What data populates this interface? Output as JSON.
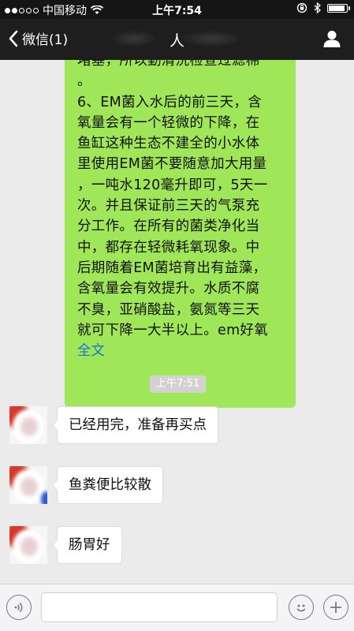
{
  "status_bar": {
    "carrier": "中国移动",
    "time": "上午7:54"
  },
  "nav": {
    "back_label": "微信(1)",
    "title": "人"
  },
  "chat": {
    "outgoing_message": {
      "text": "堵塞，所以勤清洗检查过滤棉\n。\n6、EM菌入水后的前三天，含\n氧量会有一个轻微的下降，在\n鱼缸这种生态不建全的小水体\n里使用EM菌不要随意加大用量\n，一吨水120毫升即可，5天一\n次。并且保证前三天的气泵充\n分工作。在所有的菌类净化当\n中，都存在轻微耗氧现象。中\n后期随着EM菌培育出有益藻，\n含氧量会有效提升。水质不腐\n不臭，亚硝酸盐，氨氮等三天\n就可下降一大半以上。em好氧",
      "more_label": "全文"
    },
    "timestamp": "上午7:51",
    "incoming_messages": [
      {
        "text": "已经用完，准备再买点"
      },
      {
        "text": "鱼粪便比较散"
      },
      {
        "text": "肠胃好"
      }
    ]
  },
  "colors": {
    "outgoing_bubble": "#9fe658",
    "nav_background": "#1e1e1e",
    "link": "#1f6fd1"
  }
}
